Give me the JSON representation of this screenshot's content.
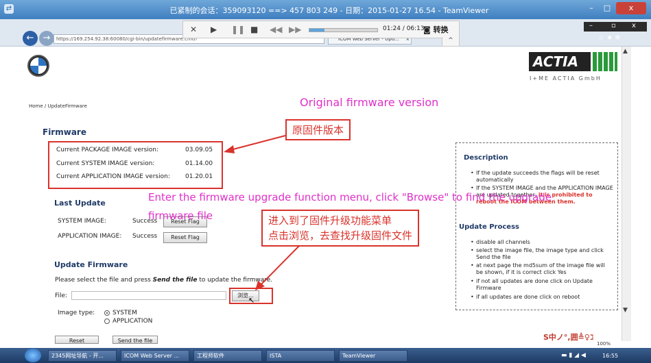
{
  "teamviewer": {
    "title": "已紧制的会话：359093120 ==> 457 803 249 - 日期：2015-01-27 16.54 - TeamViewer",
    "minimize": "–",
    "maximize": "□",
    "close": "x"
  },
  "player": {
    "time": "01:24 / 06:13",
    "progress": 0.225,
    "switch_label": "转换"
  },
  "browser": {
    "address": "https://169.254.92.38:60080/cgi-bin/updatefirmware.cmd?",
    "tab_label": "ICOM Web Server - Upd...",
    "tab_close": "x",
    "tools": "☆ ★ ✲"
  },
  "header": {
    "brand": "ACTIA",
    "brand_sub": "I+ME ACTIA GmbH"
  },
  "breadcrumb": "Home / UpdateFirmware",
  "firmware": {
    "heading": "Firmware",
    "rows": [
      {
        "label": "Current PACKAGE IMAGE version:",
        "value": "03.09.05"
      },
      {
        "label": "Current SYSTEM IMAGE version:",
        "value": "01.14.00"
      },
      {
        "label": "Current APPLICATION IMAGE version:",
        "value": "01.20.01"
      }
    ]
  },
  "last_update": {
    "heading": "Last Update",
    "system_label": "SYSTEM IMAGE:",
    "system_status": "Success",
    "app_label": "APPLICATION IMAGE:",
    "app_status": "Success",
    "reset_flag": "Reset Flag"
  },
  "update_firmware": {
    "heading": "Update Firmware",
    "instruction_pre": "Please select the file and press ",
    "instruction_em": "Send the file",
    "instruction_post": " to update the firmware.",
    "file_label": "File:",
    "browse_label": "浏览...",
    "image_type_label": "Image type:",
    "option_system": "SYSTEM",
    "option_application": "APPLICATION",
    "reset_button": "Reset",
    "send_button": "Send the file"
  },
  "description": {
    "heading": "Description",
    "bullets": [
      "If the update succeeds the flags will be reset automatically",
      "If the SYSTEM IMAGE and the APPLICATION IMAGE are updated together,"
    ],
    "warning": "it is prohibited to reboot the ICOM between them.",
    "process_heading": "Update Process",
    "process": [
      "disable all channels",
      "select the image file, the image type and click Send the file",
      "at next page the md5sum of the image file will be shown, if it is correct click Yes",
      "if not all updates are done click on Update Firmware",
      "if all updates are done click on reboot"
    ]
  },
  "annotations": {
    "original_en": "Original firmware version",
    "original_cn": "原固件版本",
    "enter_en_1": "Enter the firmware upgrade function menu, click \"Browse\" to find the upgrade",
    "enter_en_2": "firmware file",
    "enter_cn_1": "进入到了固件升级功能菜单",
    "enter_cn_2": "点击浏览，去查找升级固件文件"
  },
  "ime": "S中ノ°,囲≜♀ℷ",
  "zoom": "100%",
  "taskbar": {
    "items": [
      "2345网址导航 - 开...",
      "ICOM Web Server ...",
      "工程师软件",
      "ISTA",
      "TeamViewer"
    ],
    "clock": "16:55"
  },
  "colors": {
    "annotation_red": "#d9322b",
    "annotation_magenta": "#e02fc9",
    "heading_blue": "#1f3a66",
    "actia_green": "#2a9a3a"
  }
}
